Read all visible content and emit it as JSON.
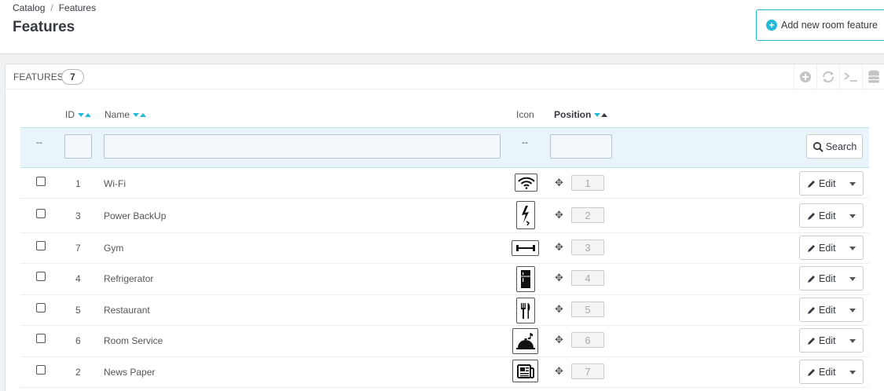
{
  "breadcrumb": {
    "parent": "Catalog",
    "separator": "/",
    "current": "Features"
  },
  "page_title": "Features",
  "add_button": {
    "label": "Add new room feature"
  },
  "panel": {
    "title": "FEATURES",
    "count": "7"
  },
  "toolbar": [
    "plus-circle-icon",
    "refresh-icon",
    "terminal-icon",
    "database-icon"
  ],
  "columns": {
    "id": "ID",
    "name": "Name",
    "icon": "Icon",
    "position": "Position"
  },
  "filters": {
    "checkbox_placeholder": "--",
    "icon_placeholder": "--",
    "search_label": "Search"
  },
  "rows": [
    {
      "id": "1",
      "name": "Wi-Fi",
      "icon": "wifi-icon",
      "position": "1",
      "edit": "Edit"
    },
    {
      "id": "3",
      "name": "Power BackUp",
      "icon": "power-backup-icon",
      "position": "2",
      "edit": "Edit"
    },
    {
      "id": "7",
      "name": "Gym",
      "icon": "dumbbell-icon",
      "position": "3",
      "edit": "Edit"
    },
    {
      "id": "4",
      "name": "Refrigerator",
      "icon": "refrigerator-icon",
      "position": "4",
      "edit": "Edit"
    },
    {
      "id": "5",
      "name": "Restaurant",
      "icon": "cutlery-icon",
      "position": "5",
      "edit": "Edit"
    },
    {
      "id": "6",
      "name": "Room Service",
      "icon": "room-service-icon",
      "position": "6",
      "edit": "Edit"
    },
    {
      "id": "2",
      "name": "News Paper",
      "icon": "newspaper-icon",
      "position": "7",
      "edit": "Edit"
    }
  ],
  "colors": {
    "accent": "#25b9d7",
    "text": "#363a41",
    "filter_bg": "#eaf5f9"
  }
}
